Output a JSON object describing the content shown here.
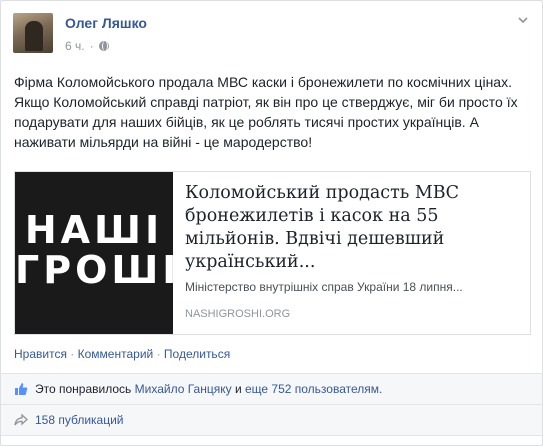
{
  "post": {
    "author": "Олег Ляшко",
    "time": "6 ч.",
    "text": "Фірма Коломойського продала МВС каски і бронежилети по космічних цінах. Якщо Коломойський справді патріот, як він про це стверджує, міг би просто їх подарувати для наших бійців, як це роблять тисячі простих українців. А наживати мільярди на війні - це мародерство!"
  },
  "share": {
    "logo_line1": "НАШІ",
    "logo_line2": "ГРОШІ",
    "title": "Коломойський продасть МВС бронежилетів і касок на 55 мільйонів. Вдвічі дешевший український...",
    "description": "Міністерство внутрішніх справ України 18 липня...",
    "domain": "NASHIGROSHI.ORG"
  },
  "actions": {
    "like": "Нравится",
    "comment": "Комментарий",
    "share": "Поделиться",
    "separator": "·"
  },
  "likes": {
    "prefix": "Это понравилось",
    "person": "Михайло Ганцяку",
    "middle": "и",
    "others": "еще 752 пользователям."
  },
  "shares": {
    "text": "158 публикаций"
  },
  "icons": {
    "globe": "globe-icon",
    "chevron": "chevron-down-icon",
    "like": "thumbs-up-icon",
    "share": "share-arrow-icon"
  }
}
